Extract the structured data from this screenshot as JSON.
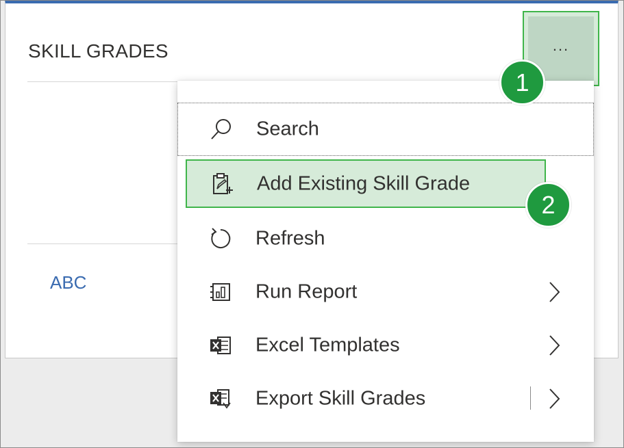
{
  "card": {
    "title": "SKILL GRADES",
    "row_link": "ABC",
    "more_button_label": "..."
  },
  "menu": {
    "items": [
      {
        "label": "Search",
        "icon": "search-icon",
        "submenu": false
      },
      {
        "label": "Add Existing Skill Grade",
        "icon": "clipboard-add-icon",
        "submenu": false
      },
      {
        "label": "Refresh",
        "icon": "refresh-icon",
        "submenu": false
      },
      {
        "label": "Run Report",
        "icon": "report-icon",
        "submenu": true
      },
      {
        "label": "Excel Templates",
        "icon": "excel-icon",
        "submenu": true
      },
      {
        "label": "Export Skill Grades",
        "icon": "excel-export-icon",
        "submenu": true
      }
    ]
  },
  "callouts": {
    "step1": "1",
    "step2": "2"
  },
  "colors": {
    "accent_blue": "#3a6bb0",
    "highlight_green": "#3fb54a",
    "badge_green": "#1f9a3f"
  }
}
